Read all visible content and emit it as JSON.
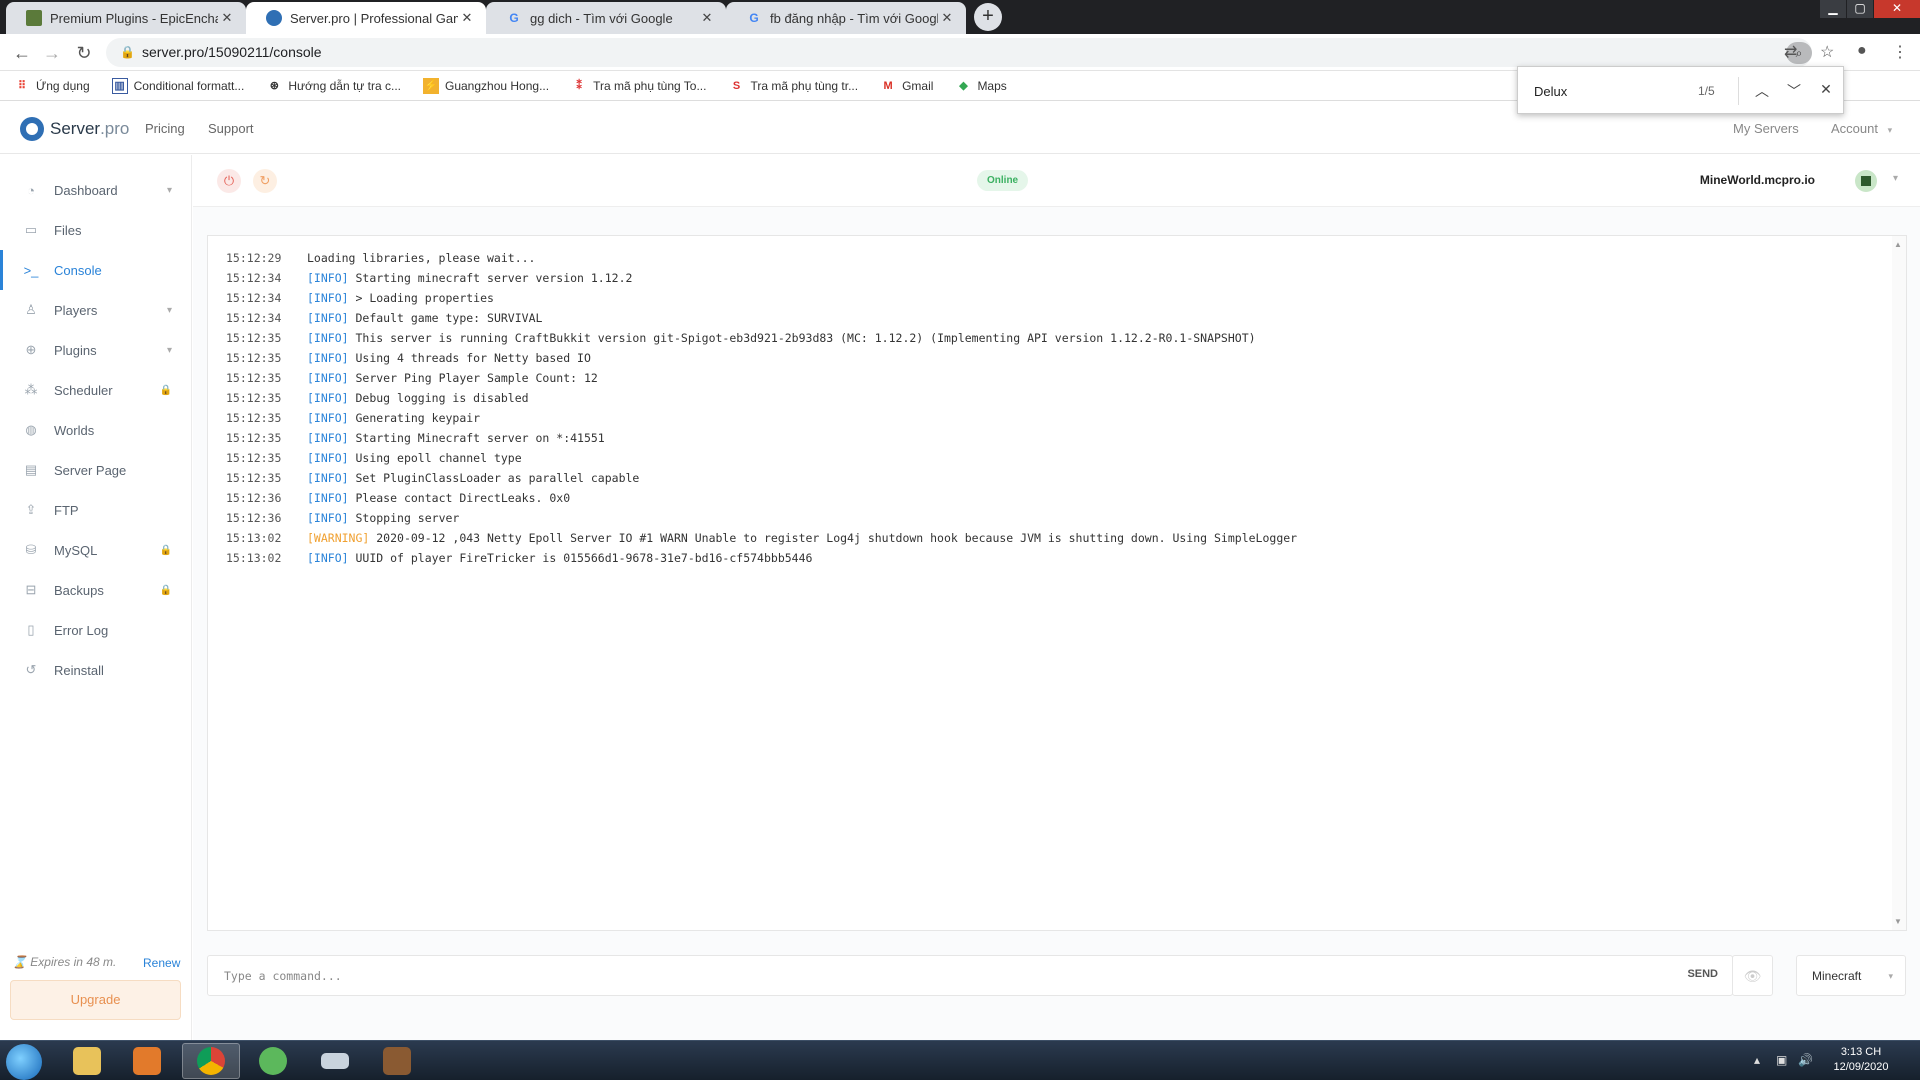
{
  "browser": {
    "tabs": [
      {
        "title": "Premium Plugins - EpicEnchants |",
        "favicon": "minecraft-block-icon"
      },
      {
        "title": "Server.pro | Professional Game Se",
        "favicon": "serverpro-icon",
        "active": true
      },
      {
        "title": "gg dich - Tìm với Google",
        "favicon": "google-icon"
      },
      {
        "title": "fb đăng nhập - Tìm với Google",
        "favicon": "google-icon"
      }
    ],
    "url": "server.pro/15090211/console",
    "bookmarks": [
      {
        "label": "Ứng dụng",
        "icon": "apps-grid-icon"
      },
      {
        "label": "Conditional formatt...",
        "icon": "bookmark-icon"
      },
      {
        "label": "Hướng dẫn tự tra c...",
        "icon": "steering-icon"
      },
      {
        "label": "Guangzhou Hong...",
        "icon": "bookmark-icon"
      },
      {
        "label": "Tra mã phụ tùng To...",
        "icon": "bookmark-icon"
      },
      {
        "label": "Tra mã phụ tùng tr...",
        "icon": "bookmark-icon"
      },
      {
        "label": "Gmail",
        "icon": "gmail-icon"
      },
      {
        "label": "Maps",
        "icon": "maps-icon"
      }
    ],
    "find": {
      "query": "Delux",
      "count": "1/5"
    }
  },
  "app": {
    "logo_main": "Server",
    "logo_suffix": ".pro",
    "nav": {
      "pricing": "Pricing",
      "support": "Support",
      "my_servers": "My Servers",
      "account": "Account"
    }
  },
  "sidebar": {
    "items": [
      {
        "label": "Dashboard",
        "icon": "dashboard-icon",
        "chevron": true
      },
      {
        "label": "Files",
        "icon": "folder-icon"
      },
      {
        "label": "Console",
        "icon": "terminal-icon",
        "active": true
      },
      {
        "label": "Players",
        "icon": "user-icon",
        "chevron": true
      },
      {
        "label": "Plugins",
        "icon": "plugin-icon",
        "chevron": true
      },
      {
        "label": "Scheduler",
        "icon": "scheduler-icon",
        "locked": true
      },
      {
        "label": "Worlds",
        "icon": "globe-icon"
      },
      {
        "label": "Server Page",
        "icon": "page-icon"
      },
      {
        "label": "FTP",
        "icon": "upload-icon"
      },
      {
        "label": "MySQL",
        "icon": "database-icon",
        "locked": true
      },
      {
        "label": "Backups",
        "icon": "archive-icon",
        "locked": true
      },
      {
        "label": "Error Log",
        "icon": "error-log-icon"
      },
      {
        "label": "Reinstall",
        "icon": "reinstall-icon"
      }
    ],
    "expires": "Expires in 48 m.",
    "renew": "Renew",
    "upgrade": "Upgrade"
  },
  "server": {
    "status": "Online",
    "name": "MineWorld.mcpro.io"
  },
  "console": {
    "lines": [
      {
        "time": "15:12:29",
        "level": "",
        "text": "Loading libraries, please wait..."
      },
      {
        "time": "15:12:34",
        "level": "[INFO]",
        "text": "Starting minecraft server version 1.12.2"
      },
      {
        "time": "15:12:34",
        "level": "[INFO]",
        "text": "> Loading properties"
      },
      {
        "time": "15:12:34",
        "level": "[INFO]",
        "text": "Default game type: SURVIVAL"
      },
      {
        "time": "15:12:35",
        "level": "[INFO]",
        "text": "This server is running CraftBukkit version git-Spigot-eb3d921-2b93d83 (MC: 1.12.2) (Implementing API version 1.12.2-R0.1-SNAPSHOT)"
      },
      {
        "time": "15:12:35",
        "level": "[INFO]",
        "text": "Using 4 threads for Netty based IO"
      },
      {
        "time": "15:12:35",
        "level": "[INFO]",
        "text": "Server Ping Player Sample Count: 12"
      },
      {
        "time": "15:12:35",
        "level": "[INFO]",
        "text": "Debug logging is disabled"
      },
      {
        "time": "15:12:35",
        "level": "[INFO]",
        "text": "Generating keypair"
      },
      {
        "time": "15:12:35",
        "level": "[INFO]",
        "text": "Starting Minecraft server on *:41551"
      },
      {
        "time": "15:12:35",
        "level": "[INFO]",
        "text": "Using epoll channel type"
      },
      {
        "time": "15:12:35",
        "level": "[INFO]",
        "text": "Set PluginClassLoader as parallel capable"
      },
      {
        "time": "15:12:36",
        "level": "[INFO]",
        "text": "Please contact DirectLeaks. 0x0"
      },
      {
        "time": "15:12:36",
        "level": "[INFO]",
        "text": "Stopping server"
      },
      {
        "time": "15:13:02",
        "level": "[WARNING]",
        "text": "2020-09-12 ,043 Netty Epoll Server IO #1 WARN Unable to register Log4j shutdown hook because JVM is shutting down. Using SimpleLogger"
      },
      {
        "time": "15:13:02",
        "level": "[INFO]",
        "text": "UUID of player FireTricker is 015566d1-9678-31e7-bd16-cf574bbb5446"
      }
    ],
    "command_placeholder": "Type a command...",
    "send_label": "SEND",
    "server_type": "Minecraft"
  },
  "taskbar": {
    "time": "3:13 CH",
    "date": "12/09/2020"
  }
}
